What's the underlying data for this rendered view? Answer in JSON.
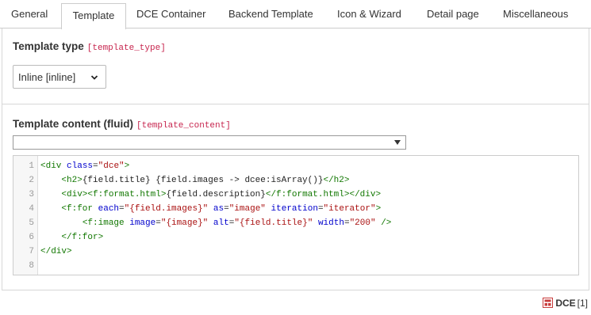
{
  "tabs": [
    "General",
    "Template",
    "DCE Container",
    "Backend Template",
    "Icon & Wizard",
    "Detail page",
    "Miscellaneous"
  ],
  "active_tab": "Template",
  "template_type": {
    "label": "Template type",
    "field": "[template_type]",
    "selected": "Inline [inline]"
  },
  "template_content": {
    "label": "Template content (fluid)",
    "field": "[template_content]",
    "snippet_selected": ""
  },
  "editor": {
    "line_numbers": [
      "1",
      "2",
      "3",
      "4",
      "5",
      "6",
      "7",
      "8"
    ],
    "lines": [
      [
        [
          "tg",
          "<div "
        ],
        [
          "at",
          "class"
        ],
        [
          "tx",
          "="
        ],
        [
          "st",
          "\"dce\""
        ],
        [
          "tg",
          ">"
        ]
      ],
      [
        [
          "tx",
          "    "
        ],
        [
          "tg",
          "<h2>"
        ],
        [
          "tx",
          "{field.title} {field.images -> dcee:isArray()}"
        ],
        [
          "tg",
          "</h2>"
        ]
      ],
      [
        [
          "tx",
          "    "
        ],
        [
          "tg",
          "<div><f:format.html>"
        ],
        [
          "tx",
          "{field.description}"
        ],
        [
          "tg",
          "</f:format.html></div>"
        ]
      ],
      [
        [
          "tx",
          "    "
        ],
        [
          "tg",
          "<f:for "
        ],
        [
          "at",
          "each"
        ],
        [
          "tx",
          "="
        ],
        [
          "st",
          "\"{field.images}\""
        ],
        [
          "tx",
          " "
        ],
        [
          "at",
          "as"
        ],
        [
          "tx",
          "="
        ],
        [
          "st",
          "\"image\""
        ],
        [
          "tx",
          " "
        ],
        [
          "at",
          "iteration"
        ],
        [
          "tx",
          "="
        ],
        [
          "st",
          "\"iterator\""
        ],
        [
          "tg",
          ">"
        ]
      ],
      [
        [
          "tx",
          "        "
        ],
        [
          "tg",
          "<f:image "
        ],
        [
          "at",
          "image"
        ],
        [
          "tx",
          "="
        ],
        [
          "st",
          "\"{image}\""
        ],
        [
          "tx",
          " "
        ],
        [
          "at",
          "alt"
        ],
        [
          "tx",
          "="
        ],
        [
          "st",
          "\"{field.title}\""
        ],
        [
          "tx",
          " "
        ],
        [
          "at",
          "width"
        ],
        [
          "tx",
          "="
        ],
        [
          "st",
          "\"200\""
        ],
        [
          "tx",
          " "
        ],
        [
          "tg",
          "/>"
        ]
      ],
      [
        [
          "tx",
          "    "
        ],
        [
          "tg",
          "</f:for>"
        ]
      ],
      [
        [
          "tg",
          "</div>"
        ]
      ],
      []
    ]
  },
  "footer": {
    "icon": "dce-record-icon",
    "name": "DCE",
    "count": "[1]",
    "icon_color": "#c83c3c"
  }
}
